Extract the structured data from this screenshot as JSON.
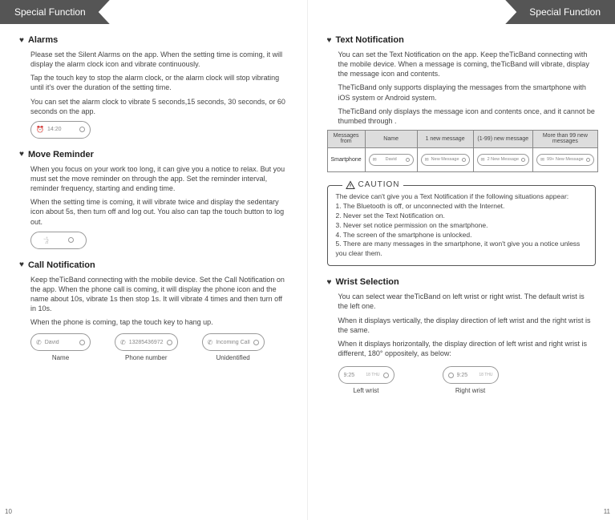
{
  "header": {
    "left": "Special Function",
    "right": "Special Function"
  },
  "pageNum": {
    "left": "10",
    "right": "11"
  },
  "alarms": {
    "title": "Alarms",
    "p1": " Please set the Silent Alarms on the app. When the setting time is coming, it will display the alarm clock icon and vibrate continuously.",
    "p2": " Tap the touch key to stop the alarm clock, or the alarm clock will stop vibrating until it's over the duration of the setting time.",
    "p3": " You can set the alarm clock to vibrate 5 seconds,15 seconds, 30 seconds, or 60 seconds on the app.",
    "pillTime": "14:20"
  },
  "move": {
    "title": "Move Reminder",
    "p1": " When you focus on your work too long, it can give you a notice to relax. But you must set the move reminder on through the app. Set the reminder interval, reminder frequency, starting and ending time.",
    "p2": " When the setting time is coming, it will vibrate twice and display the sedentary icon about 5s, then turn off and log out. You also can tap the touch button to log out."
  },
  "call": {
    "title": "Call Notification",
    "p1": "Keep theTicBand connecting with the mobile device. Set the Call Notification on the app. When the phone call is coming, it will display the phone icon and the name about 10s, vibrate 1s then stop 1s. It will vibrate 4 times and then turn off in 10s.",
    "p2": "When the phone is coming, tap the touch key to hang up.",
    "name": "David",
    "number": "13285436972",
    "unid": "Incoming Call",
    "lblName": "Name",
    "lblPhone": "Phone number",
    "lblUnid": "Unidentified"
  },
  "text": {
    "title": "Text Notification",
    "p1": "You can set the Text Notification on the app. Keep theTicBand connecting with the mobile device. When a message is coming, theTicBand will vibrate, display the message icon and contents.",
    "p2": "TheTicBand only supports displaying the messages from the smartphone with iOS system or Android system.",
    "p3": "TheTicBand only displays the message icon and contents once, and it cannot be thumbed through .",
    "table": {
      "h0": "Messages from",
      "h1": "Name",
      "h2": "1 new message",
      "h3": "(1-99) new message",
      "h4": "More than 99 new messages",
      "rowLabel": "Smartphone",
      "c1": "David",
      "c2": "New Message",
      "c3": "2 New Message",
      "c4": "99+ New Message"
    }
  },
  "caution": {
    "label": "CAUTION",
    "intro": "The device can't give you a Text Notification if the following situations appear:",
    "i1": "1. The Bluetooth is off, or unconnected with the Internet.",
    "i2": "2. Never set the Text Notification on.",
    "i3": "3. Never set notice permission on the smartphone.",
    "i4": "4. The screen of the smartphone is unlocked.",
    "i5": "5. There are many messages in the smartphone, it won't give you a notice unless you clear them."
  },
  "wrist": {
    "title": "Wrist Selection",
    "p1": " You can select wear theTicBand on left wrist or right wrist. The default wrist is the left one.",
    "p2": "When it displays vertically, the display direction of left wrist and the right wrist is the same.",
    "p3": "When it displays horizontally, the display direction of left wrist and right wrist is different, 180° oppositely, as below:",
    "time": "9:25",
    "date": "18 THU",
    "lblLeft": "Left wrist",
    "lblRight": "Right wrist"
  }
}
